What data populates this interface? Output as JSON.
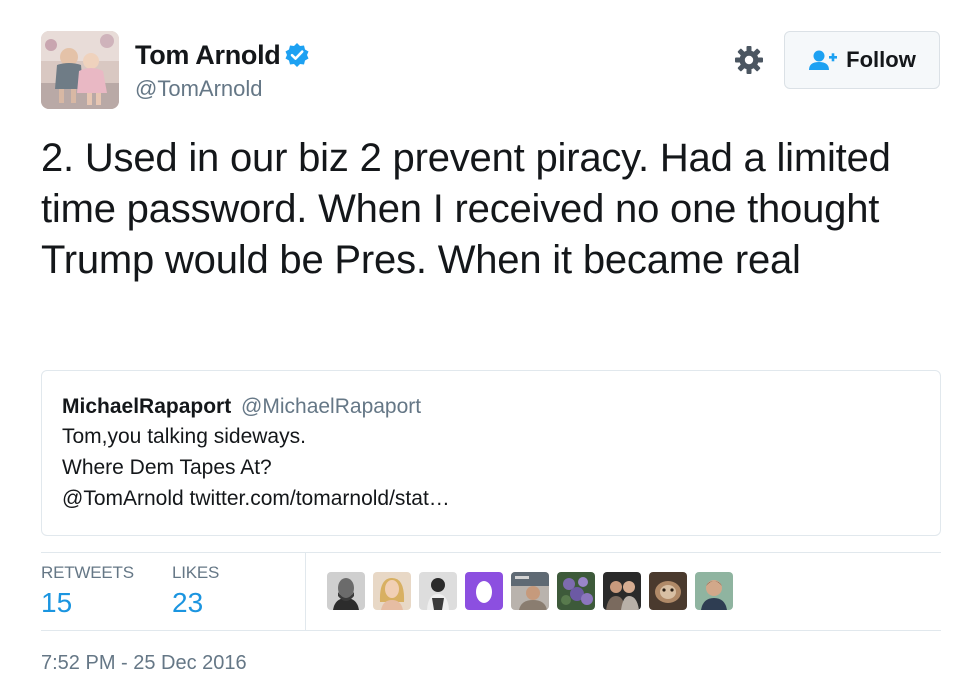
{
  "author": {
    "display_name": "Tom Arnold",
    "handle": "@TomArnold",
    "verified": true,
    "avatar_icon": "profile-photo-children"
  },
  "actions": {
    "settings_icon": "gear-icon",
    "follow_label": "Follow",
    "follow_icon": "add-user-icon"
  },
  "tweet": {
    "text": "2. Used in our biz 2 prevent piracy. Had a limited time password. When I received no one thought Trump would be Pres. When it became real"
  },
  "quote": {
    "name": "MichaelRapaport",
    "handle": "@MichaelRapaport",
    "lines": [
      "Tom,you talking sideways.",
      "Where Dem Tapes At?",
      "@TomArnold twitter.com/tomarnold/stat…"
    ]
  },
  "stats": {
    "retweets_label": "RETWEETS",
    "retweets_count": "15",
    "likes_label": "LIKES",
    "likes_count": "23"
  },
  "timestamp": "7:52 PM - 25 Dec 2016",
  "colors": {
    "link_blue": "#1b95e0",
    "verified_blue": "#1da1f2",
    "secondary_text": "#657786",
    "border": "#e1e8ed"
  }
}
